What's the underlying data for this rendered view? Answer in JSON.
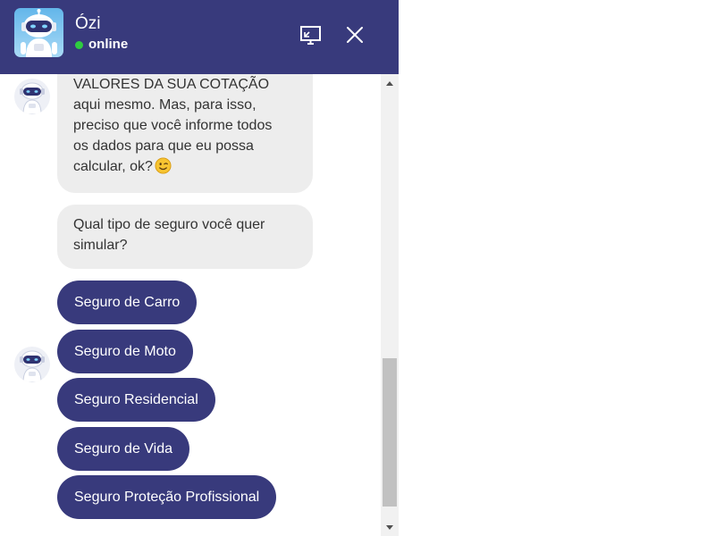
{
  "header": {
    "bot_name": "Ózi",
    "status": "online",
    "avatar_icon": "robot-avatar-icon",
    "accent_color": "#383a7c",
    "status_color": "#2ecc40"
  },
  "messages": [
    {
      "lines": [
        "VALORES DA SUA COTAÇÃO",
        "aqui mesmo. Mas, para isso,",
        "preciso que você informe todos",
        "os dados para que eu possa",
        "calcular, ok?"
      ],
      "emoji": "winking-face-emoji"
    },
    {
      "lines": [
        "Qual tipo de seguro você quer",
        "simular?"
      ]
    }
  ],
  "options": [
    {
      "label": "Seguro de Carro"
    },
    {
      "label": "Seguro de Moto"
    },
    {
      "label": "Seguro Residencial"
    },
    {
      "label": "Seguro de Vida"
    },
    {
      "label": "Seguro Proteção Profissional"
    }
  ]
}
